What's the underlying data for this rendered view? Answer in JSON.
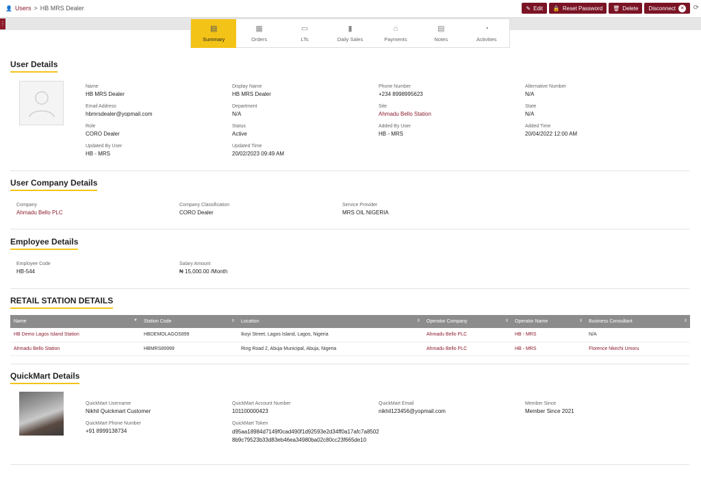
{
  "breadcrumb": {
    "root": "Users",
    "separator": ">",
    "current": "HB MRS Dealer"
  },
  "actions": {
    "edit": "Edit",
    "reset_password": "Reset Password",
    "delete": "Delete",
    "disconnect": "Disconnect"
  },
  "tabs": [
    {
      "label": "Summary",
      "icon": "summary-icon",
      "active": true
    },
    {
      "label": "Orders",
      "icon": "orders-icon"
    },
    {
      "label": "LTs",
      "icon": "lts-icon"
    },
    {
      "label": "Daily Sales",
      "icon": "daily-sales-icon"
    },
    {
      "label": "Payments",
      "icon": "payments-icon"
    },
    {
      "label": "Notes",
      "icon": "notes-icon"
    },
    {
      "label": "Activities",
      "icon": "activities-icon"
    }
  ],
  "user_details": {
    "title": "User Details",
    "fields": [
      {
        "label": "Name",
        "value": "HB MRS Dealer"
      },
      {
        "label": "Display Name",
        "value": "HB MRS Dealer"
      },
      {
        "label": "Phone Number",
        "value": "+234 8998995623"
      },
      {
        "label": "Alternative Number",
        "value": "N/A"
      },
      {
        "label": "Email Address",
        "value": "hbmrsdealer@yopmail.com"
      },
      {
        "label": "Department",
        "value": "N/A"
      },
      {
        "label": "Site",
        "value": "Ahmadu Bello Station"
      },
      {
        "label": "State",
        "value": "N/A"
      },
      {
        "label": "Role",
        "value": "CORO Dealer"
      },
      {
        "label": "Status",
        "value": "Active"
      },
      {
        "label": "Added By User",
        "value": "HB - MRS"
      },
      {
        "label": "Added Time",
        "value": "20/04/2022 12:00 AM"
      },
      {
        "label": "Updated By User",
        "value": "HB - MRS"
      },
      {
        "label": "Updated Time",
        "value": "20/02/2023 09:49 AM"
      }
    ]
  },
  "company_details": {
    "title": "User Company Details",
    "fields": [
      {
        "label": "Company",
        "value": "Ahmadu Bello PLC"
      },
      {
        "label": "Company Classification",
        "value": "CORO Dealer"
      },
      {
        "label": "Service Provider",
        "value": "MRS OIL NIGERIA"
      }
    ]
  },
  "employee_details": {
    "title": "Employee Details",
    "fields": [
      {
        "label": "Employee Code",
        "value": "HB-544"
      },
      {
        "label": "Salary Amount",
        "value": "₦ 15,000.00 /Month"
      }
    ]
  },
  "retail_stations": {
    "title": "RETAIL STATION DETAILS",
    "columns": [
      "Name",
      "Station Code",
      "Location",
      "Operator Company",
      "Operator Name",
      "Business Consultant"
    ],
    "rows": [
      [
        "HB Demo Lagos Island Station",
        "HBDEMOLAGOS899",
        "Ikoyi Street, Lagos Island, Lagos, Nigeria",
        "Ahmadu Bello PLC",
        "HB - MRS",
        "N/A"
      ],
      [
        "Ahmadu Bello Station",
        "HBMRS89999",
        "Ring Road 2, Abuja Municipal, Abuja, Nigeria",
        "Ahmadu Bello PLC",
        "HB - MRS",
        "Florence Nkechi Umoru"
      ]
    ]
  },
  "quickmart": {
    "title": "QuickMart Details",
    "fields": [
      {
        "label": "QuickMart Username",
        "value": "Nikhil Quickmart Customer"
      },
      {
        "label": "QuickMart Account Number",
        "value": "101100000423"
      },
      {
        "label": "QuickMart Email",
        "value": "nikhil123456@yopmail.com"
      },
      {
        "label": "Member Since",
        "value": "Member Since 2021"
      },
      {
        "label": "QuickMart Phone Number",
        "value": "+91 8999138734"
      },
      {
        "label": "QuickMart Token",
        "value": "d95aa18984d7149f0cad490f1d92593e2d34ff0a17afc7a85028b9c79523b33d83eb46ea34980ba02c80cc23f665de10"
      }
    ]
  },
  "colors": {
    "brand": "#7a1425",
    "accent": "#f3c318",
    "link": "#8b1a2b"
  }
}
